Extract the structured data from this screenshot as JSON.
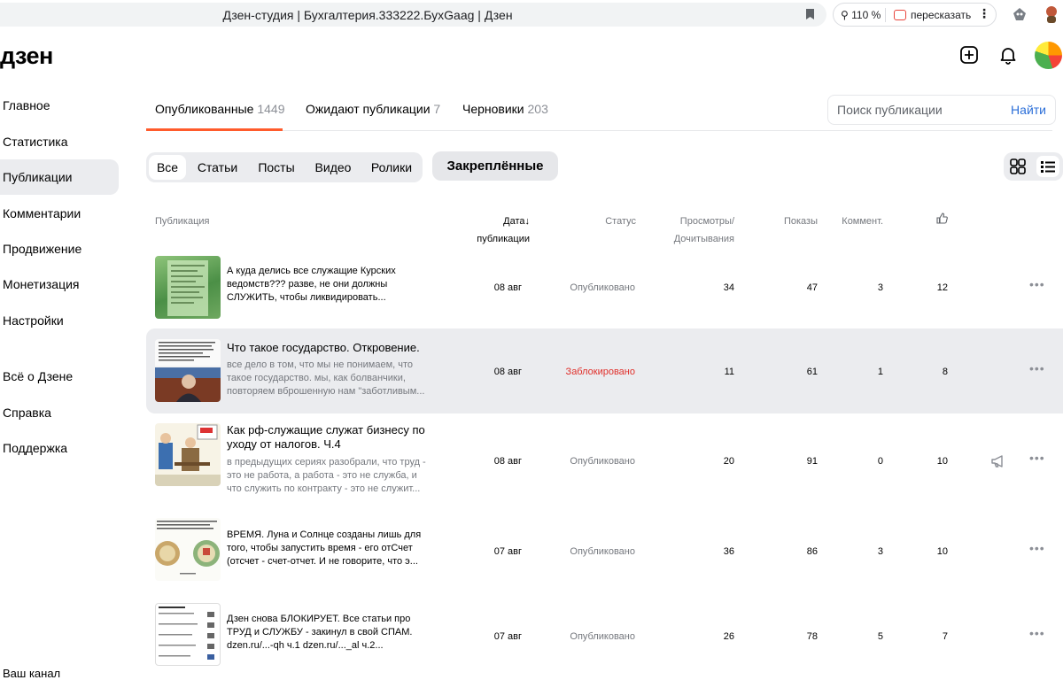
{
  "browser": {
    "tab_title": "Дзен-студия | Бухгалтерия.333222.БухGaag | Дзен",
    "zoom": "110 %",
    "retell": "пересказать"
  },
  "header": {
    "logo": "дзен"
  },
  "sidebar": {
    "items": [
      {
        "label": "Главное"
      },
      {
        "label": "Статистика"
      },
      {
        "label": "Публикации",
        "active": true
      },
      {
        "label": "Комментарии"
      },
      {
        "label": "Продвижение"
      },
      {
        "label": "Монетизация"
      },
      {
        "label": "Настройки"
      },
      {
        "label": "Всё о Дзене"
      },
      {
        "label": "Справка"
      },
      {
        "label": "Поддержка"
      }
    ],
    "footer": "Ваш канал"
  },
  "tabs": [
    {
      "label": "Опубликованные",
      "count": "1449"
    },
    {
      "label": "Ожидают публикации",
      "count": "7"
    },
    {
      "label": "Черновики",
      "count": "203"
    }
  ],
  "search": {
    "placeholder": "Поиск публикации",
    "button": "Найти"
  },
  "filters": {
    "chips": [
      "Все",
      "Статьи",
      "Посты",
      "Видео",
      "Ролики"
    ],
    "pinned": "Закреплённые"
  },
  "columns": {
    "publication": "Публикация",
    "date_line1": "Дата↓",
    "date_line2": "публикации",
    "status": "Статус",
    "views_line1": "Просмотры/",
    "views_line2": "Дочитывания",
    "impressions": "Показы",
    "comments": "Коммент."
  },
  "rows": [
    {
      "title": "А куда делись все служащие Курских ведомств??? разве, не они должны СЛУЖИТЬ, чтобы ликвидировать...",
      "desc": [],
      "date": "08 авг",
      "status": "Опубликовано",
      "views": "34",
      "impressions": "47",
      "comments": "3",
      "likes": "12"
    },
    {
      "title": "Что такое государство. Откровение.",
      "desc": [
        "все дело в том, что мы не понимаем, что",
        "такое государство. мы, как болванчики,",
        "повторяем вброшенную нам \"заботливым..."
      ],
      "date": "08 авг",
      "status": "Заблокировано",
      "views": "11",
      "impressions": "61",
      "comments": "1",
      "likes": "8"
    },
    {
      "title": "Как рф-служащие служат бизнесу по уходу от налогов. Ч.4",
      "desc": [
        "в предыдущих сериях разобрали, что труд -",
        "это не работа, а работа - это не служба, и",
        "что служить по контракту - это не служит..."
      ],
      "date": "08 авг",
      "status": "Опубликовано",
      "views": "20",
      "impressions": "91",
      "comments": "0",
      "likes": "10"
    },
    {
      "title": "ВРЕМЯ. Луна и Солнце созданы лишь для того, чтобы запустить время - его отСчет (отсчет - счет-отчет. И не говорите, что э...",
      "desc": [],
      "date": "07 авг",
      "status": "Опубликовано",
      "views": "36",
      "impressions": "86",
      "comments": "3",
      "likes": "10"
    },
    {
      "title": "Дзен снова БЛОКИРУЕТ. Все статьи про ТРУД и СЛУЖБУ - закинул в свой СПАМ. dzen.ru/...-qh ч.1 dzen.ru/..._al ч.2...",
      "desc": [],
      "date": "07 авг",
      "status": "Опубликовано",
      "views": "26",
      "impressions": "78",
      "comments": "5",
      "likes": "7"
    }
  ],
  "colors": {
    "accent": "#ff5b2c",
    "blocked": "#e0302b",
    "link": "#2a6ed8"
  }
}
